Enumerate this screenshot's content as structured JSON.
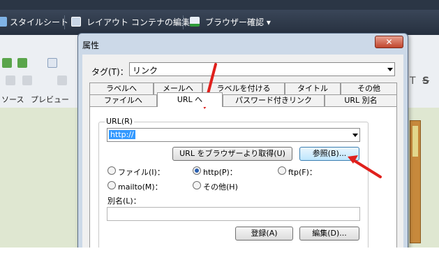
{
  "toolbar": {
    "stylesheet": "スタイルシート",
    "layout_edit": "レイアウト コンテナの編集 ▾",
    "browser_check": "ブラウザー確認 ▾"
  },
  "app_tabs": {
    "source": "ソース",
    "preview": "プレビュー"
  },
  "dialog": {
    "title": "属性",
    "close_label": "✕",
    "tag_label": "タグ(T)：",
    "tag_value": "リンク",
    "tabs_row1": [
      "ラベルへ",
      "メールへ",
      "ラベルを付ける",
      "タイトル",
      "その他"
    ],
    "tabs_row2": [
      "ファイルへ",
      "URL へ",
      "パスワード付きリンク",
      "URL 別名"
    ],
    "url_group_label": "URL(R)",
    "url_value": "http://",
    "get_url_button": "URL をブラウザーより取得(U)",
    "browse_button": "参照(B)...",
    "radios": {
      "file": "ファイル(I)：",
      "http": "http(P)：",
      "ftp": "ftp(F)：",
      "mailto": "mailto(M)：",
      "other": "その他(H)"
    },
    "alias_label": "別名(L)：",
    "alias_value": "",
    "register_button": "登録(A)",
    "edit_button": "編集(D)..."
  },
  "colors": {
    "annotation_arrow": "#e0201c",
    "url_selection": "#3399ff"
  }
}
